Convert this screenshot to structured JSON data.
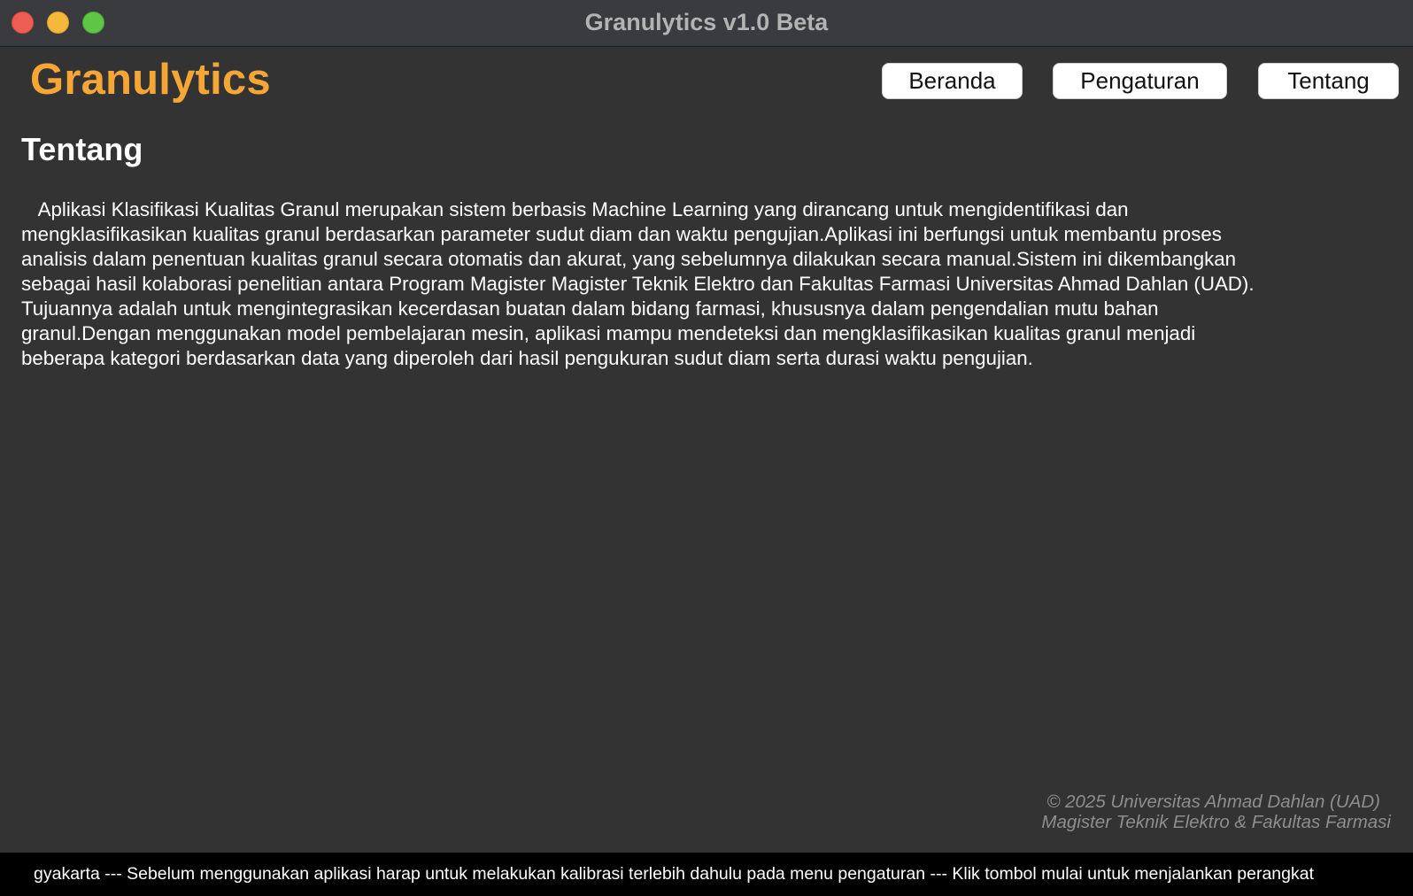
{
  "window": {
    "title": "Granulytics v1.0 Beta"
  },
  "header": {
    "brand": "Granulytics",
    "nav": {
      "beranda": "Beranda",
      "pengaturan": "Pengaturan",
      "tentang": "Tentang"
    }
  },
  "main": {
    "title": "Tentang",
    "description": "   Aplikasi Klasifikasi Kualitas Granul merupakan sistem berbasis Machine Learning yang dirancang untuk mengidentifikasi dan mengklasifikasikan kualitas granul berdasarkan parameter sudut diam dan waktu pengujian.Aplikasi ini berfungsi untuk membantu proses analisis dalam penentuan kualitas granul secara otomatis dan akurat, yang sebelumnya dilakukan secara manual.Sistem ini dikembangkan sebagai hasil kolaborasi penelitian antara Program Magister Magister Teknik Elektro dan Fakultas Farmasi Universitas Ahmad Dahlan (UAD). Tujuannya adalah untuk mengintegrasikan kecerdasan buatan dalam bidang farmasi, khususnya dalam pengendalian mutu bahan granul.Dengan menggunakan model pembelajaran mesin, aplikasi mampu mendeteksi dan mengklasifikasikan kualitas granul menjadi beberapa kategori berdasarkan data yang diperoleh dari hasil pengukuran sudut diam serta durasi waktu pengujian."
  },
  "footer": {
    "credit_line1": "© 2025 Universitas Ahmad Dahlan (UAD)",
    "credit_line2": "Magister Teknik Elektro & Fakultas Farmasi"
  },
  "ticker": {
    "text": "gyakarta --- Sebelum menggunakan aplikasi harap untuk melakukan kalibrasi terlebih dahulu pada menu pengaturan --- Klik tombol mulai untuk menjalankan perangkat"
  },
  "colors": {
    "background": "#333333",
    "brand": "#f5a634",
    "titlebar": "#3a3b3e",
    "ticker_bg": "#000000"
  }
}
